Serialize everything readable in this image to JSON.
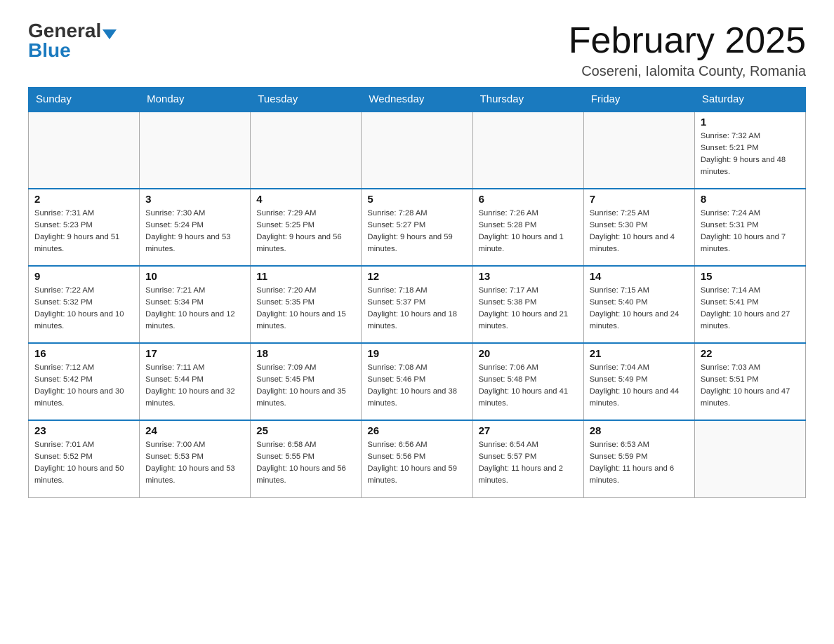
{
  "header": {
    "logo_general": "General",
    "logo_blue": "Blue",
    "month_title": "February 2025",
    "location": "Cosereni, Ialomita County, Romania"
  },
  "weekdays": [
    "Sunday",
    "Monday",
    "Tuesday",
    "Wednesday",
    "Thursday",
    "Friday",
    "Saturday"
  ],
  "weeks": [
    [
      {
        "day": "",
        "info": ""
      },
      {
        "day": "",
        "info": ""
      },
      {
        "day": "",
        "info": ""
      },
      {
        "day": "",
        "info": ""
      },
      {
        "day": "",
        "info": ""
      },
      {
        "day": "",
        "info": ""
      },
      {
        "day": "1",
        "info": "Sunrise: 7:32 AM\nSunset: 5:21 PM\nDaylight: 9 hours and 48 minutes."
      }
    ],
    [
      {
        "day": "2",
        "info": "Sunrise: 7:31 AM\nSunset: 5:23 PM\nDaylight: 9 hours and 51 minutes."
      },
      {
        "day": "3",
        "info": "Sunrise: 7:30 AM\nSunset: 5:24 PM\nDaylight: 9 hours and 53 minutes."
      },
      {
        "day": "4",
        "info": "Sunrise: 7:29 AM\nSunset: 5:25 PM\nDaylight: 9 hours and 56 minutes."
      },
      {
        "day": "5",
        "info": "Sunrise: 7:28 AM\nSunset: 5:27 PM\nDaylight: 9 hours and 59 minutes."
      },
      {
        "day": "6",
        "info": "Sunrise: 7:26 AM\nSunset: 5:28 PM\nDaylight: 10 hours and 1 minute."
      },
      {
        "day": "7",
        "info": "Sunrise: 7:25 AM\nSunset: 5:30 PM\nDaylight: 10 hours and 4 minutes."
      },
      {
        "day": "8",
        "info": "Sunrise: 7:24 AM\nSunset: 5:31 PM\nDaylight: 10 hours and 7 minutes."
      }
    ],
    [
      {
        "day": "9",
        "info": "Sunrise: 7:22 AM\nSunset: 5:32 PM\nDaylight: 10 hours and 10 minutes."
      },
      {
        "day": "10",
        "info": "Sunrise: 7:21 AM\nSunset: 5:34 PM\nDaylight: 10 hours and 12 minutes."
      },
      {
        "day": "11",
        "info": "Sunrise: 7:20 AM\nSunset: 5:35 PM\nDaylight: 10 hours and 15 minutes."
      },
      {
        "day": "12",
        "info": "Sunrise: 7:18 AM\nSunset: 5:37 PM\nDaylight: 10 hours and 18 minutes."
      },
      {
        "day": "13",
        "info": "Sunrise: 7:17 AM\nSunset: 5:38 PM\nDaylight: 10 hours and 21 minutes."
      },
      {
        "day": "14",
        "info": "Sunrise: 7:15 AM\nSunset: 5:40 PM\nDaylight: 10 hours and 24 minutes."
      },
      {
        "day": "15",
        "info": "Sunrise: 7:14 AM\nSunset: 5:41 PM\nDaylight: 10 hours and 27 minutes."
      }
    ],
    [
      {
        "day": "16",
        "info": "Sunrise: 7:12 AM\nSunset: 5:42 PM\nDaylight: 10 hours and 30 minutes."
      },
      {
        "day": "17",
        "info": "Sunrise: 7:11 AM\nSunset: 5:44 PM\nDaylight: 10 hours and 32 minutes."
      },
      {
        "day": "18",
        "info": "Sunrise: 7:09 AM\nSunset: 5:45 PM\nDaylight: 10 hours and 35 minutes."
      },
      {
        "day": "19",
        "info": "Sunrise: 7:08 AM\nSunset: 5:46 PM\nDaylight: 10 hours and 38 minutes."
      },
      {
        "day": "20",
        "info": "Sunrise: 7:06 AM\nSunset: 5:48 PM\nDaylight: 10 hours and 41 minutes."
      },
      {
        "day": "21",
        "info": "Sunrise: 7:04 AM\nSunset: 5:49 PM\nDaylight: 10 hours and 44 minutes."
      },
      {
        "day": "22",
        "info": "Sunrise: 7:03 AM\nSunset: 5:51 PM\nDaylight: 10 hours and 47 minutes."
      }
    ],
    [
      {
        "day": "23",
        "info": "Sunrise: 7:01 AM\nSunset: 5:52 PM\nDaylight: 10 hours and 50 minutes."
      },
      {
        "day": "24",
        "info": "Sunrise: 7:00 AM\nSunset: 5:53 PM\nDaylight: 10 hours and 53 minutes."
      },
      {
        "day": "25",
        "info": "Sunrise: 6:58 AM\nSunset: 5:55 PM\nDaylight: 10 hours and 56 minutes."
      },
      {
        "day": "26",
        "info": "Sunrise: 6:56 AM\nSunset: 5:56 PM\nDaylight: 10 hours and 59 minutes."
      },
      {
        "day": "27",
        "info": "Sunrise: 6:54 AM\nSunset: 5:57 PM\nDaylight: 11 hours and 2 minutes."
      },
      {
        "day": "28",
        "info": "Sunrise: 6:53 AM\nSunset: 5:59 PM\nDaylight: 11 hours and 6 minutes."
      },
      {
        "day": "",
        "info": ""
      }
    ]
  ]
}
